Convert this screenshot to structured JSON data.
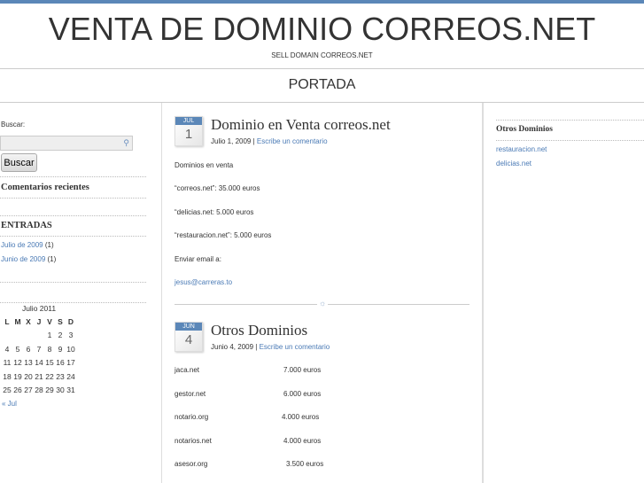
{
  "header": {
    "title": "VENTA DE DOMINIO CORREOS.NET",
    "subtitle": "SELL DOMAIN CORREOS.NET",
    "nav": "PORTADA"
  },
  "left_sidebar": {
    "search_label": "Buscar:",
    "search_value": "",
    "search_button": "Buscar",
    "recent_comments": "Comentarios recientes",
    "entries_title": "ENTRADAS",
    "archives": [
      {
        "label": "Julio de 2009",
        "count": "(1)"
      },
      {
        "label": "Junio de 2009",
        "count": "(1)"
      }
    ],
    "calendar": {
      "caption": "Julio 2011",
      "days": [
        "L",
        "M",
        "X",
        "J",
        "V",
        "S",
        "D"
      ],
      "weeks": [
        [
          "",
          "",
          "",
          "",
          "1",
          "2",
          "3"
        ],
        [
          "4",
          "5",
          "6",
          "7",
          "8",
          "9",
          "10"
        ],
        [
          "11",
          "12",
          "13",
          "14",
          "15",
          "16",
          "17"
        ],
        [
          "18",
          "19",
          "20",
          "21",
          "22",
          "23",
          "24"
        ],
        [
          "25",
          "26",
          "27",
          "28",
          "29",
          "30",
          "31"
        ]
      ],
      "prev": "« Jul"
    }
  },
  "posts": [
    {
      "month": "JUL",
      "day": "1",
      "title": "Dominio en Venta correos.net",
      "date": "Julio 1, 2009",
      "sep": "|",
      "comment": "Escribe un comentario",
      "lines": [
        "Dominios en venta",
        "“correos.net”: 35.000 euros",
        "“delicias.net: 5.000 euros",
        "“restauracion.net”: 5.000 euros",
        "Enviar email a:"
      ],
      "email": "jesus@carreras.to"
    },
    {
      "month": "JUN",
      "day": "4",
      "title": "Otros Dominios",
      "date": "Junio 4, 2009",
      "sep": "|",
      "comment": "Escribe un comentario",
      "rows": [
        {
          "domain": "jaca.net",
          "price": "7.000 euros"
        },
        {
          "domain": "gestor.net",
          "price": "6.000 euros"
        },
        {
          "domain": "notario.org",
          "price": "4.000 euros"
        },
        {
          "domain": "notarios.net",
          "price": "4.000 euros"
        },
        {
          "domain": "asesor.org",
          "price": "3.500 euros"
        }
      ]
    }
  ],
  "right_sidebar": {
    "title": "Otros Dominios",
    "links": [
      "restauracion.net",
      "delicias.net"
    ]
  }
}
